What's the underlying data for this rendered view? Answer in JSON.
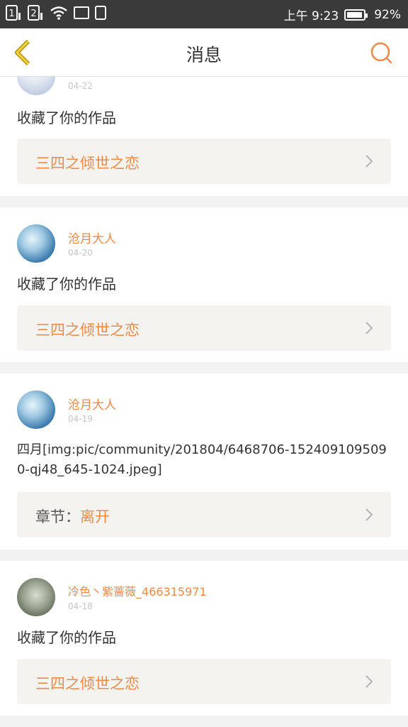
{
  "statusbar": {
    "sim1": "1",
    "sim2": "2",
    "time": "上午 9:23",
    "battery": "92%"
  },
  "navbar": {
    "title": "消息"
  },
  "colors": {
    "accent": "#f08a4b",
    "back_icon": "#e6c229",
    "link_bg": "#f4f3ef"
  },
  "messages": [
    {
      "user": "",
      "date": "04-22",
      "content": "收藏了你的作品",
      "link": {
        "prefix": "",
        "title": "三四之倾世之恋"
      }
    },
    {
      "user": "沧月大人",
      "date": "04-20",
      "content": "收藏了你的作品",
      "link": {
        "prefix": "",
        "title": "三四之倾世之恋"
      }
    },
    {
      "user": "沧月大人",
      "date": "04-19",
      "content": "四月[img:pic/community/201804/6468706-1524091095090-qj48_645-1024.jpeg]",
      "link": {
        "prefix": "章节：",
        "title": "离开"
      }
    },
    {
      "user": "冷色丶紫蔷薇_466315971",
      "date": "04-18",
      "content": "收藏了你的作品",
      "link": {
        "prefix": "",
        "title": "三四之倾世之恋"
      }
    }
  ]
}
